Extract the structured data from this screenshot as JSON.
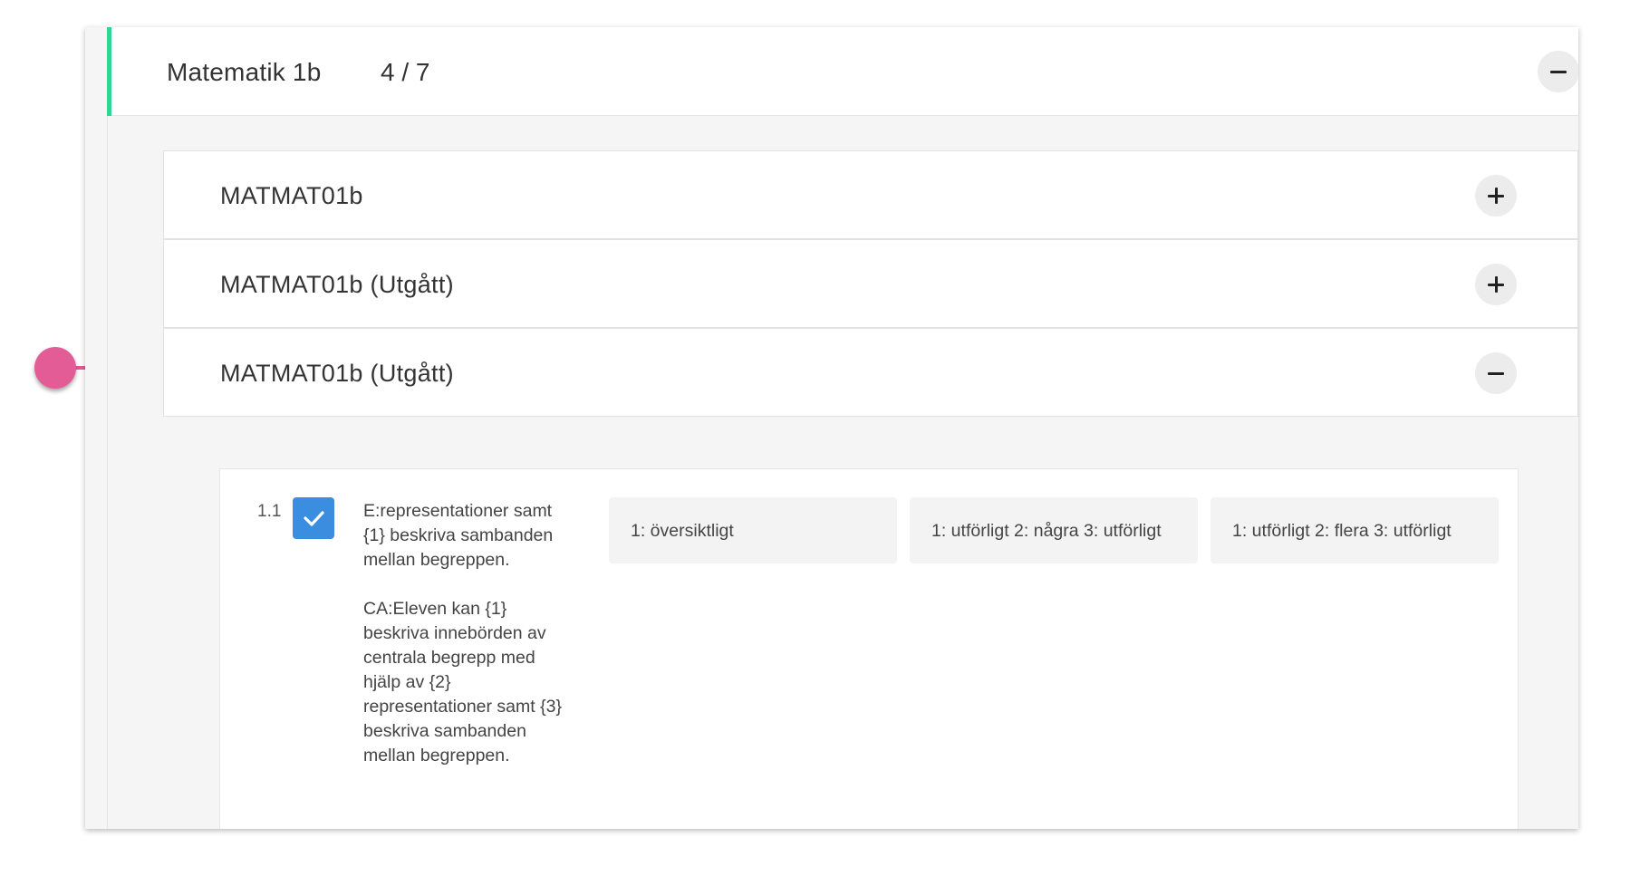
{
  "course": {
    "title": "Matematik 1b",
    "progress": "4 / 7",
    "expanded": true
  },
  "modules": [
    {
      "title": "MATMAT01b",
      "expanded": false
    },
    {
      "title": "MATMAT01b (Utgått)",
      "expanded": false
    },
    {
      "title": "MATMAT01b (Utgått)",
      "expanded": true
    }
  ],
  "criteria": {
    "number": "1.1",
    "checked": true,
    "text_e": "E:representationer samt {1} beskriva sambanden mellan begreppen.",
    "text_ca": "CA:Eleven kan {1} beskriva innebörden av centrala begrepp med hjälp av {2} representationer samt {3} beskriva sambanden mellan begreppen.",
    "levels": [
      "1: översiktligt",
      "1: utförligt 2: några 3: utförligt",
      "1: utförligt 2: flera 3: utförligt"
    ]
  },
  "colors": {
    "accent_green": "#2fd592",
    "connector_pink": "#e45c96",
    "checkbox_blue": "#3b8de0"
  },
  "icons": {
    "collapse": "minus-icon",
    "expand": "plus-icon",
    "check": "check-icon"
  }
}
